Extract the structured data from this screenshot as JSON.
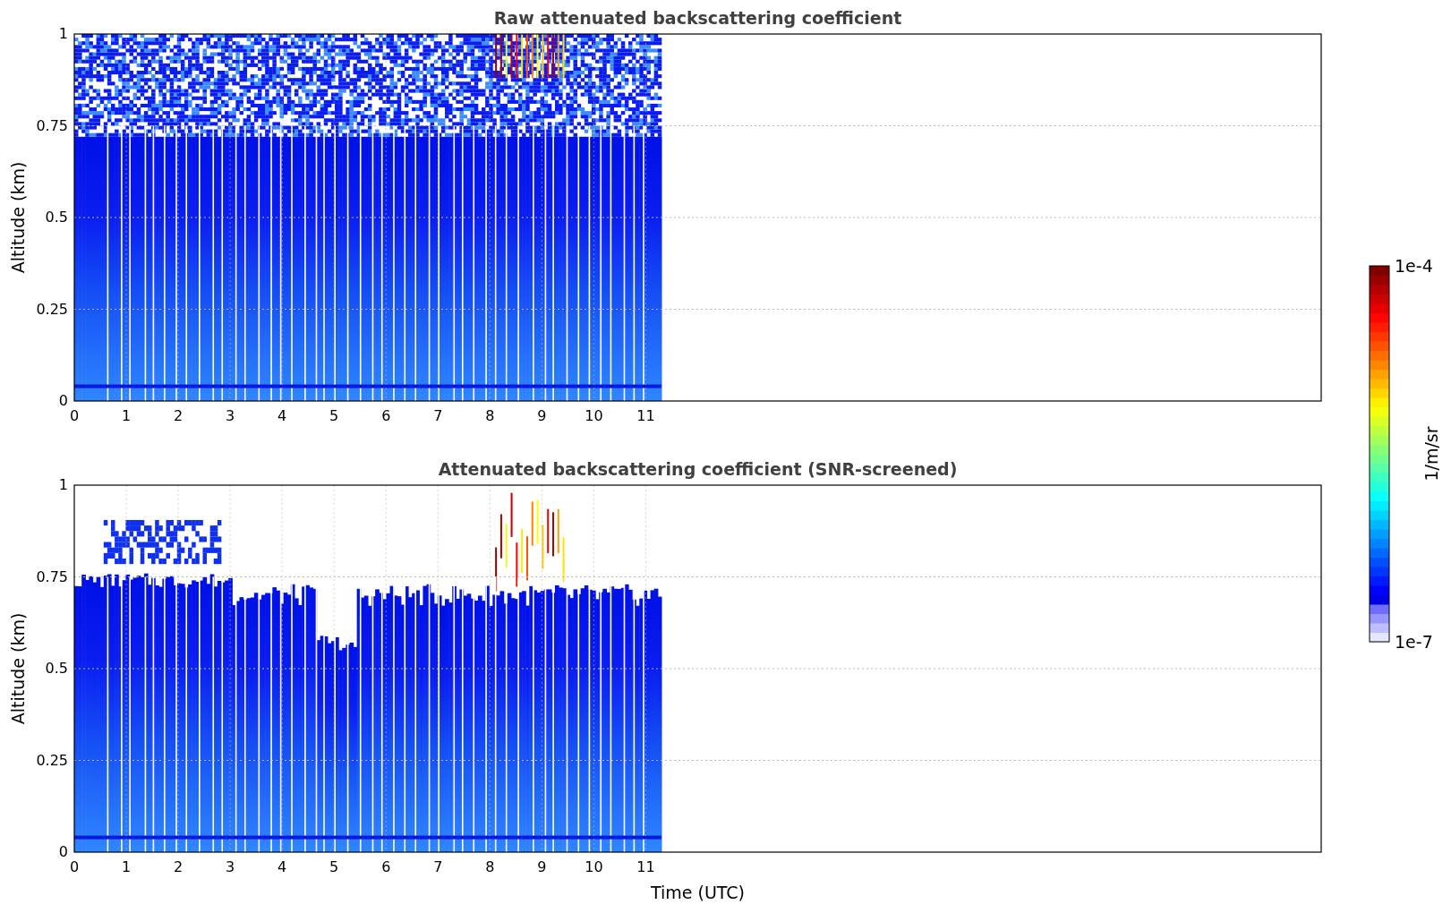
{
  "panels": [
    {
      "kind": "raw",
      "title": "Raw attenuated backscattering coefficient",
      "ylabel": "Altitude (km)",
      "yticks": [
        "1",
        "0.75",
        "0.5",
        "0.25",
        "0"
      ],
      "xticks": [
        "0",
        "1",
        "2",
        "3",
        "4",
        "5",
        "6",
        "7",
        "8",
        "9",
        "10",
        "11"
      ]
    },
    {
      "kind": "screened",
      "title": "Attenuated backscattering coefficient (SNR-screened)",
      "ylabel": "Altitude (km)",
      "xlabel": "Time (UTC)",
      "yticks": [
        "1",
        "0.75",
        "0.5",
        "0.25",
        "0"
      ],
      "xticks": [
        "0",
        "1",
        "2",
        "3",
        "4",
        "5",
        "6",
        "7",
        "8",
        "9",
        "10",
        "11"
      ]
    }
  ],
  "colorbar": {
    "label": "1/m/sr",
    "max": "1e-4",
    "min": "1e-7"
  }
}
